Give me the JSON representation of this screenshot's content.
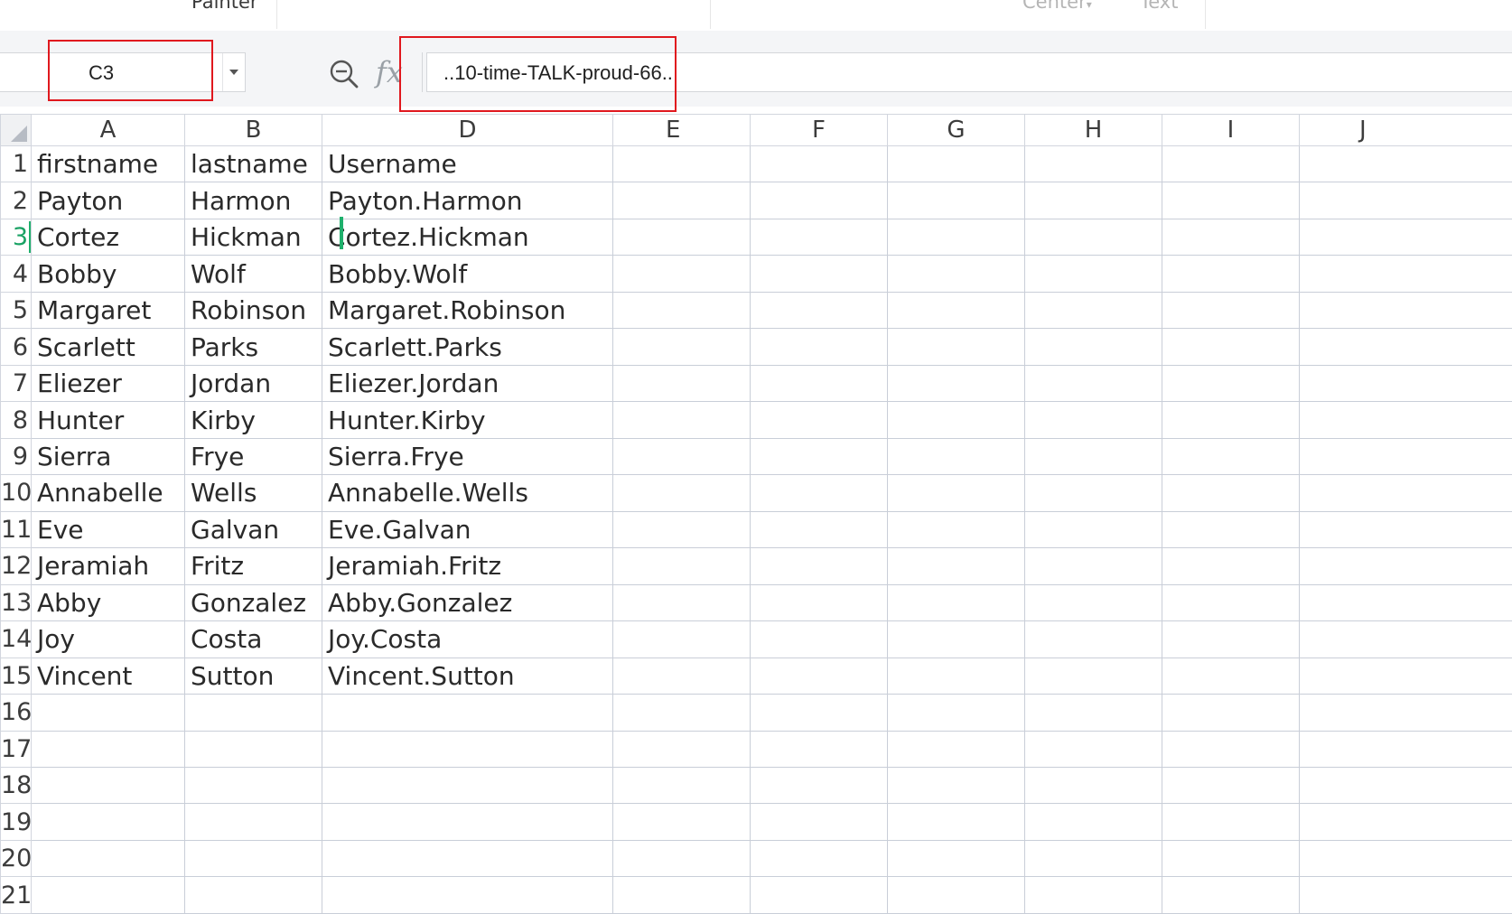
{
  "ribbon": {
    "format_painter_label": "Painter",
    "merge_center_label": "Center",
    "merge_center_arrow": "▾",
    "wrap_text_label": "Text"
  },
  "formula_bar": {
    "name_box_value": "C3",
    "fx_label": "fx",
    "formula_value": "..10-time-TALK-proud-66..",
    "zoom_icon": "zoom-out-magnifier-icon",
    "highlight_color": "#e0181e"
  },
  "sheet": {
    "columns": [
      "A",
      "B",
      "D",
      "E",
      "F",
      "G",
      "H",
      "I",
      "J"
    ],
    "row_numbers": [
      "1",
      "2",
      "3",
      "4",
      "5",
      "6",
      "7",
      "8",
      "9",
      "10",
      "11",
      "12",
      "13",
      "14",
      "15",
      "16",
      "17",
      "18",
      "19",
      "20",
      "21"
    ],
    "selected_row": "3",
    "selection_color": "#1fb06c",
    "rows": [
      [
        "firstname",
        "lastname",
        "Username"
      ],
      [
        "Payton",
        "Harmon",
        "Payton.Harmon"
      ],
      [
        "Cortez",
        "Hickman",
        "Cortez.Hickman"
      ],
      [
        "Bobby",
        "Wolf",
        "Bobby.Wolf"
      ],
      [
        "Margaret",
        "Robinson",
        "Margaret.Robinson"
      ],
      [
        "Scarlett",
        "Parks",
        "Scarlett.Parks"
      ],
      [
        "Eliezer",
        "Jordan",
        "Eliezer.Jordan"
      ],
      [
        "Hunter",
        "Kirby",
        "Hunter.Kirby"
      ],
      [
        "Sierra",
        "Frye",
        "Sierra.Frye"
      ],
      [
        "Annabelle",
        "Wells",
        "Annabelle.Wells"
      ],
      [
        "Eve",
        "Galvan",
        "Eve.Galvan"
      ],
      [
        "Jeramiah",
        "Fritz",
        "Jeramiah.Fritz"
      ],
      [
        "Abby",
        "Gonzalez",
        "Abby.Gonzalez"
      ],
      [
        "Joy",
        "Costa",
        "Joy.Costa"
      ],
      [
        "Vincent",
        "Sutton",
        "Vincent.Sutton"
      ],
      [
        "",
        "",
        ""
      ],
      [
        "",
        "",
        ""
      ],
      [
        "",
        "",
        ""
      ],
      [
        "",
        "",
        ""
      ],
      [
        "",
        "",
        ""
      ],
      [
        "",
        "",
        ""
      ]
    ]
  }
}
